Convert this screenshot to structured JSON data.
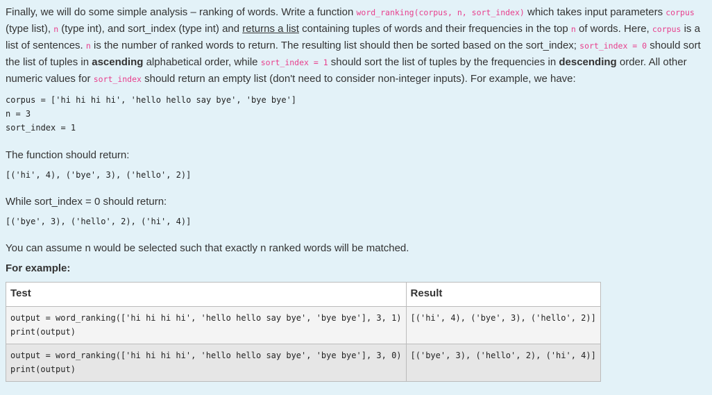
{
  "intro": {
    "t1": "Finally, we will do some simple analysis – ranking of words. Write a function ",
    "c1": "word_ranking(corpus, n, sort_index)",
    "t2": " which takes input parameters ",
    "c2": "corpus",
    "t3": " (type list), ",
    "c3": "n",
    "t4": " (type int), and sort_index (type int) and ",
    "u1": "returns a list",
    "t5": " containing tuples of words and their frequencies in the top ",
    "c4": "n",
    "t6": " of words. Here, ",
    "c5": "corpus",
    "t7": " is a list of sentences. ",
    "c6": "n",
    "t8": " is the number of ranked words to return. The resulting list should then be sorted based on the sort_index; ",
    "c7": "sort_index = 0",
    "t9": " should sort the list of tuples in ",
    "b1": "ascending",
    "t10": " alphabetical order, while ",
    "c8": "sort_index = 1",
    "t11": " should sort the list of tuples by the frequencies in ",
    "b2": "descending",
    "t12": " order. All other numeric values for ",
    "c9": "sort_index",
    "t13": " should return an empty list (don't need to consider non-integer inputs). For example, we have:"
  },
  "example_code": [
    "corpus = ['hi hi hi hi', 'hello hello say bye', 'bye bye']",
    "n = 3",
    "sort_index = 1"
  ],
  "return_text": "The function should return:",
  "return_value": "[('hi', 4), ('bye', 3), ('hello', 2)]",
  "while_text": "While sort_index = 0 should return:",
  "while_value": "[('bye', 3), ('hello', 2), ('hi', 4)]",
  "assume_text": "You can assume n would be selected such that exactly n ranked words will be matched.",
  "for_example": "For example:",
  "table": {
    "headers": [
      "Test",
      "Result"
    ],
    "rows": [
      {
        "test": "output = word_ranking(['hi hi hi hi', 'hello hello say bye', 'bye bye'], 3, 1)\nprint(output)",
        "result": "[('hi', 4), ('bye', 3), ('hello', 2)]"
      },
      {
        "test": "output = word_ranking(['hi hi hi hi', 'hello hello say bye', 'bye bye'], 3, 0)\nprint(output)",
        "result": "[('bye', 3), ('hello', 2), ('hi', 4)]"
      }
    ]
  },
  "colors": {
    "background": "#e3f2f8",
    "inline_code": "#e83e8c"
  }
}
